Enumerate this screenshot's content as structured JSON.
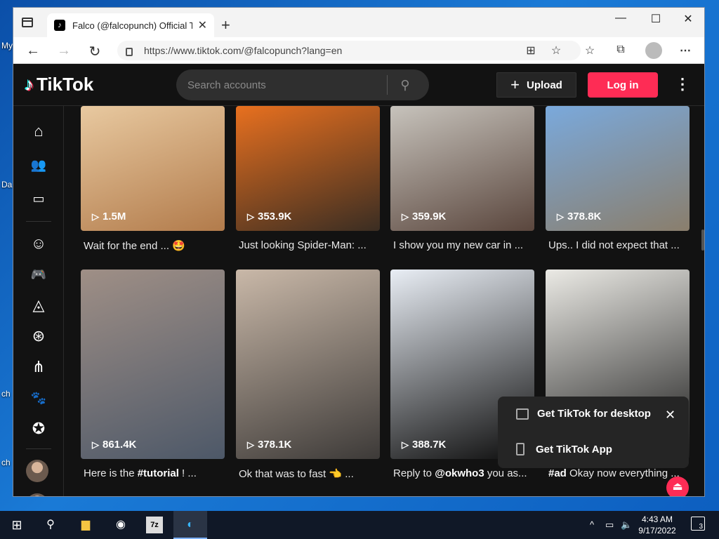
{
  "desktop": {
    "labels": [
      "My",
      "Da",
      "ch",
      "ch"
    ]
  },
  "browser": {
    "tab_title": "Falco (@falcopunch) Official TikT",
    "tab_favicon": "tiktok-favicon",
    "url": "https://www.tiktok.com/@falcopunch?lang=en"
  },
  "header": {
    "logo_text": "TikTok",
    "search_placeholder": "Search accounts",
    "upload_label": "Upload",
    "login_label": "Log in"
  },
  "sidebar": {
    "icons": [
      "home-icon",
      "following-icon",
      "live-icon",
      "comedy-icon",
      "gaming-icon",
      "food-icon",
      "dance-icon",
      "beauty-icon",
      "animals-icon",
      "sports-icon"
    ]
  },
  "videos": [
    {
      "views": "1.5M",
      "caption": "Wait for the end ... 🤩",
      "caption_bold": "",
      "colors": [
        "#e8c9a0",
        "#b27b4b"
      ]
    },
    {
      "views": "353.9K",
      "caption": "Just looking Spider-Man: ...",
      "caption_bold": "",
      "colors": [
        "#e8701f",
        "#3a2d22"
      ]
    },
    {
      "views": "359.9K",
      "caption": "I show you my new car in ...",
      "caption_bold": "",
      "colors": [
        "#c7c3bc",
        "#5a463d"
      ]
    },
    {
      "views": "378.8K",
      "caption": "Ups.. I did not expect that ...",
      "caption_bold": "",
      "colors": [
        "#7aa9dc",
        "#8a7e6c"
      ]
    },
    {
      "views": "861.4K",
      "caption_pre": "Here is the ",
      "caption_bold": "#tutorial",
      "caption_post": " ! ...",
      "colors": [
        "#9f8f86",
        "#4d5868"
      ]
    },
    {
      "views": "378.1K",
      "caption_pre": "Ok that was to fast ",
      "caption_bold": "",
      "caption_post": "👈 ...",
      "colors": [
        "#c9b8a8",
        "#3d3a38"
      ]
    },
    {
      "views": "388.7K",
      "caption_pre": "Reply to ",
      "caption_bold": "@okwho3",
      "caption_post": " you as...",
      "colors": [
        "#e9eef5",
        "#0c0c0c"
      ]
    },
    {
      "views": "",
      "caption_pre": "",
      "caption_bold": "#ad",
      "caption_post": " Okay now everything ...",
      "colors": [
        "#ebeae5",
        "#1a1a1a"
      ]
    }
  ],
  "popup": {
    "desktop_label": "Get TikTok for desktop",
    "app_label": "Get TikTok App"
  },
  "taskbar": {
    "time": "4:43 AM",
    "date": "9/17/2022",
    "notifications": "3"
  }
}
